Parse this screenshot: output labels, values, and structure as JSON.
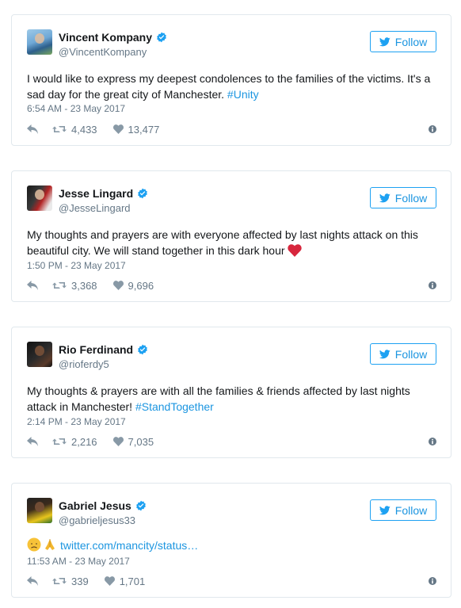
{
  "follow_label": "Follow",
  "accent_color": "#1da1f2",
  "tweets": [
    {
      "name": "Vincent Kompany",
      "handle": "@VincentKompany",
      "text": "I would like to express my deepest condolences to the families of the victims. It's a sad day for the great city of Manchester. ",
      "hashtag": "#Unity",
      "time": "6:54 AM - 23 May 2017",
      "retweets": "4,433",
      "likes": "13,477"
    },
    {
      "name": "Jesse Lingard",
      "handle": "@JesseLingard",
      "text": "My thoughts and prayers are with everyone affected by last nights attack on this beautiful city. We will stand together in this dark hour",
      "emoji": "red-heart-icon",
      "time": "1:50 PM - 23 May 2017",
      "retweets": "3,368",
      "likes": "9,696"
    },
    {
      "name": "Rio Ferdinand",
      "handle": "@rioferdy5",
      "text": "My thoughts & prayers are with all the families & friends affected by last nights attack in Manchester! ",
      "hashtag": "#StandTogether",
      "time": "2:14 PM - 23 May 2017",
      "retweets": "2,216",
      "likes": "7,035"
    },
    {
      "name": "Gabriel Jesus",
      "handle": "@gabrieljesus33",
      "emojis": [
        "disappointed-face-icon",
        "folded-hands-icon"
      ],
      "link": "twitter.com/mancity/status…",
      "time": "11:53 AM - 23 May 2017",
      "retweets": "339",
      "likes": "1,701"
    }
  ]
}
